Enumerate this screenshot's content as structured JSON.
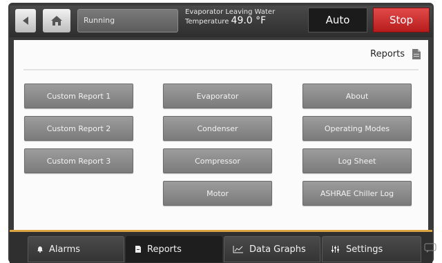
{
  "header": {
    "status_text": "Running",
    "evap_line1": "Evaporator Leaving Water",
    "evap_line2": "Temperature",
    "evap_value": "49.0 °F",
    "auto_label": "Auto",
    "stop_label": "Stop",
    "colors": {
      "stop": "#c62828",
      "auto": "#1b1b1b"
    }
  },
  "page": {
    "title": "Reports"
  },
  "buttons": {
    "column1": [
      "Custom Report 1",
      "Custom Report 2",
      "Custom Report 3"
    ],
    "column2": [
      "Evaporator",
      "Condenser",
      "Compressor",
      "Motor"
    ],
    "column3": [
      "About",
      "Operating Modes",
      "Log Sheet",
      "ASHRAE Chiller Log"
    ]
  },
  "tabs": [
    {
      "label": "Alarms",
      "icon": "bell-icon"
    },
    {
      "label": "Reports",
      "icon": "document-icon"
    },
    {
      "label": "Data Graphs",
      "icon": "line-graph-icon"
    },
    {
      "label": "Settings",
      "icon": "sliders-icon"
    }
  ],
  "accent_color": "#d9a441"
}
